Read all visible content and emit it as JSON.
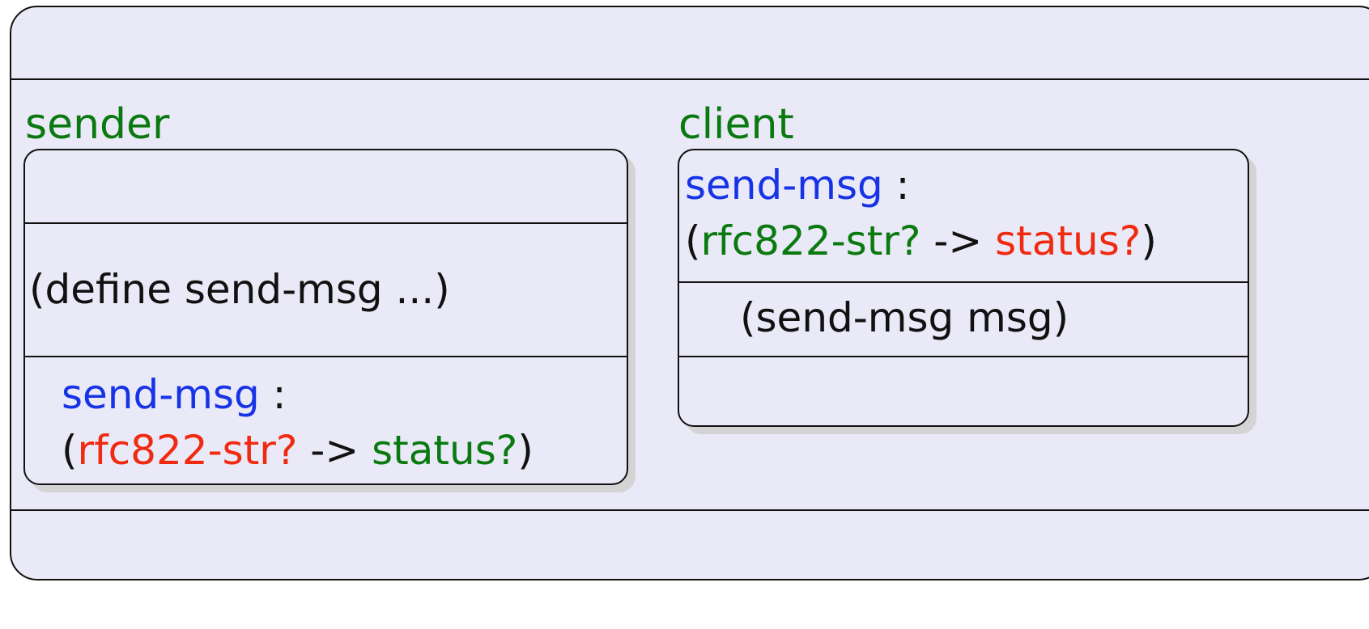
{
  "colors": {
    "background": "#e9e9f7",
    "border": "#111111",
    "module_label": "#0a7a10",
    "function_name": "#1733e6",
    "red_contract": "#f02a10",
    "green_contract": "#0a7a10",
    "plain_text": "#111111",
    "shadow": "#d4d4d4"
  },
  "sender": {
    "label": "sender",
    "definition": "(define send-msg ...)",
    "export": {
      "name": "send-msg",
      "colon": " :",
      "open_paren": "(",
      "domain": "rfc822-str?",
      "arrow": " -> ",
      "range": "status?",
      "close_paren": ")"
    }
  },
  "client": {
    "label": "client",
    "import": {
      "name": "send-msg",
      "colon": " :",
      "open_paren": "(",
      "domain": "rfc822-str?",
      "arrow": " -> ",
      "range": "status?",
      "close_paren": ")"
    },
    "call": "(send-msg msg)"
  }
}
